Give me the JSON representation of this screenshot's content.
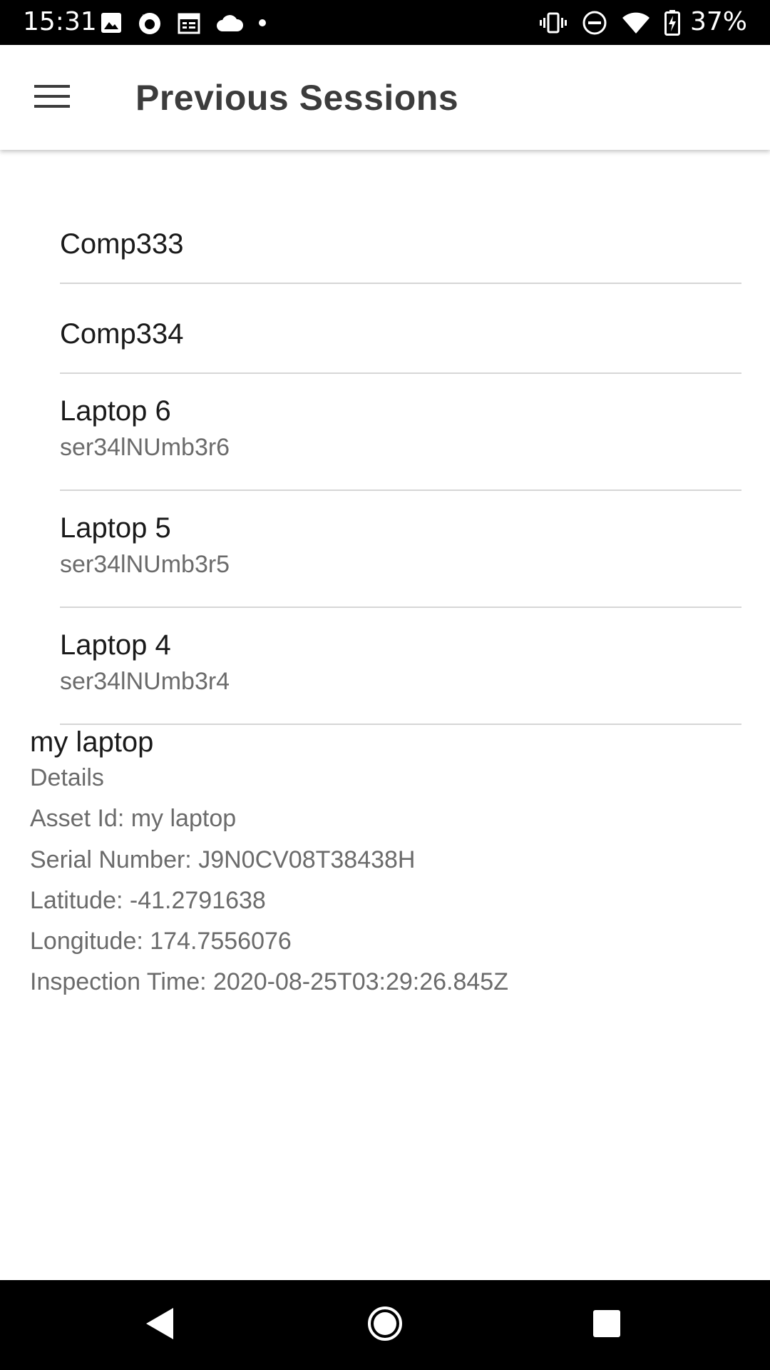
{
  "status_bar": {
    "time": "15:31",
    "left_icons": [
      "image-icon",
      "firefox-icon",
      "calendar-icon",
      "cloud-icon",
      "dot-icon"
    ],
    "right_icons": [
      "vibrate-icon",
      "do-not-disturb-icon",
      "wifi-icon",
      "battery-charging-icon"
    ],
    "battery_percent": "37%"
  },
  "app_bar": {
    "menu_icon": "hamburger-menu-icon",
    "title": "Previous Sessions"
  },
  "sessions": [
    {
      "title": "Comp333",
      "subtitle": ""
    },
    {
      "title": "Comp334",
      "subtitle": ""
    },
    {
      "title": "Laptop 6",
      "subtitle": "ser34lNUmb3r6"
    },
    {
      "title": "Laptop 5",
      "subtitle": "ser34lNUmb3r5"
    },
    {
      "title": "Laptop 4",
      "subtitle": "ser34lNUmb3r4"
    }
  ],
  "details": {
    "heading": "my laptop",
    "label": "Details",
    "asset_id": "Asset Id: my laptop",
    "serial_number": "Serial Number: J9N0CV08T38438H",
    "latitude": "Latitude: -41.2791638",
    "longitude": "Longitude: 174.7556076",
    "inspection_time": "Inspection Time: 2020-08-25T03:29:26.845Z"
  },
  "nav_bar": {
    "back_icon": "back-triangle-icon",
    "home_icon": "home-circle-icon",
    "recents_icon": "recents-square-icon"
  },
  "colors": {
    "status_bar_bg": "#000000",
    "app_bar_bg": "#ffffff",
    "title_text": "#3c3c3c",
    "primary_text": "#1a1a1a",
    "secondary_text": "#6b6b6b",
    "divider": "#d6d6d6",
    "nav_bar_bg": "#000000"
  }
}
